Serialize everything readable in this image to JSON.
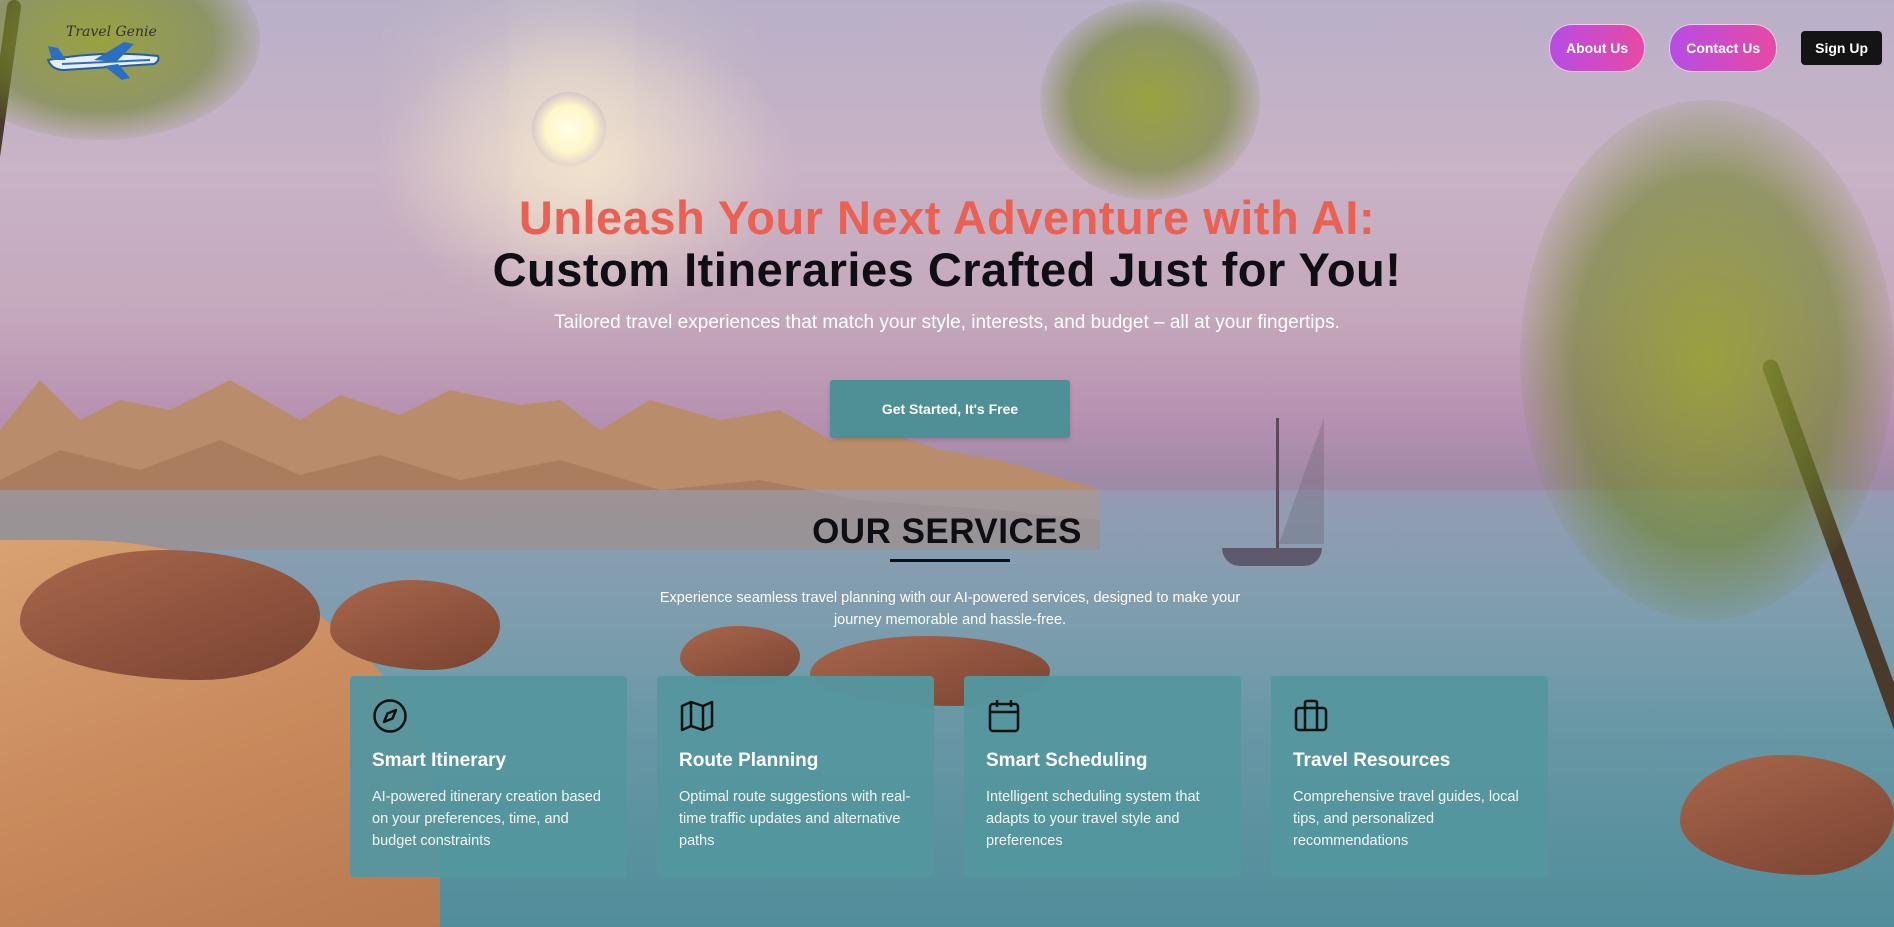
{
  "header": {
    "logo_text": "Travel Genie",
    "nav": {
      "about_label": "About Us",
      "contact_label": "Contact Us",
      "signup_label": "Sign Up"
    }
  },
  "hero": {
    "headline_line1": "Unleash Your Next Adventure with AI:",
    "headline_line2": "Custom Itineraries Crafted Just for You!",
    "subtitle": "Tailored travel experiences that match your style, interests, and budget – all at your fingertips.",
    "cta_label": "Get Started, It's Free"
  },
  "services": {
    "title": "OUR SERVICES",
    "description": "Experience seamless travel planning with our AI-powered services, designed to make your journey memorable and hassle-free.",
    "cards": [
      {
        "icon": "compass-icon",
        "title": "Smart Itinerary",
        "text": "AI-powered itinerary creation based on your preferences, time, and budget constraints"
      },
      {
        "icon": "map-icon",
        "title": "Route Planning",
        "text": "Optimal route suggestions with real-time traffic updates and alternative paths"
      },
      {
        "icon": "calendar-icon",
        "title": "Smart Scheduling",
        "text": "Intelligent scheduling system that adapts to your travel style and preferences"
      },
      {
        "icon": "briefcase-icon",
        "title": "Travel Resources",
        "text": "Comprehensive travel guides, local tips, and personalized recommendations"
      }
    ]
  },
  "colors": {
    "headline_accent": "#ea6052",
    "card_bg": "#54969e",
    "cta_bg": "#4f8f96",
    "nav_gradient_start": "#b74ce5",
    "nav_gradient_end": "#e74aa3"
  }
}
